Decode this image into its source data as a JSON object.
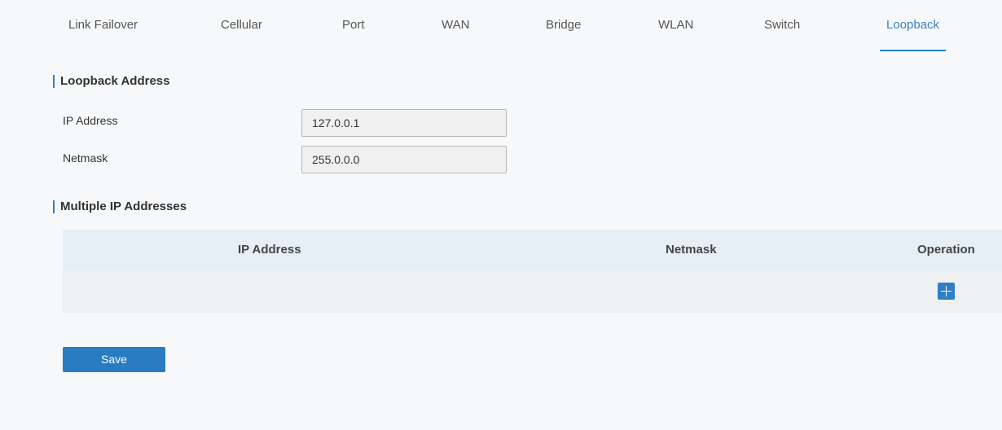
{
  "tabs": [
    {
      "label": "Link Failover"
    },
    {
      "label": "Cellular"
    },
    {
      "label": "Port"
    },
    {
      "label": "WAN"
    },
    {
      "label": "Bridge"
    },
    {
      "label": "WLAN"
    },
    {
      "label": "Switch"
    },
    {
      "label": "Loopback",
      "active": true
    }
  ],
  "loopback": {
    "title": "Loopback Address",
    "ip_label": "IP Address",
    "ip_value": "127.0.0.1",
    "netmask_label": "Netmask",
    "netmask_value": "255.0.0.0"
  },
  "multiple": {
    "title": "Multiple IP Addresses",
    "columns": [
      "IP Address",
      "Netmask",
      "Operation"
    ]
  },
  "actions": {
    "save_label": "Save"
  },
  "colors": {
    "accent": "#2e80c5",
    "table_header": "#e6eef6",
    "background": "#f7f8fa"
  }
}
